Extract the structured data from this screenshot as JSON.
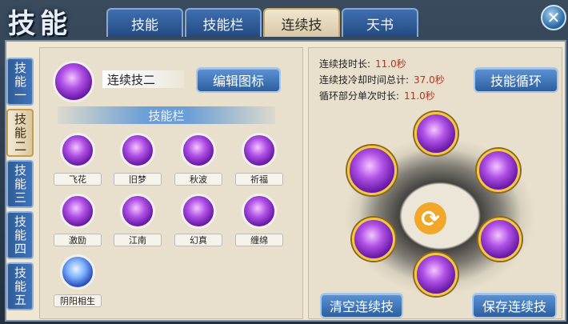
{
  "window": {
    "title": "技能"
  },
  "tabs": [
    {
      "label": "技能",
      "active": false
    },
    {
      "label": "技能栏",
      "active": false
    },
    {
      "label": "连续技",
      "active": true
    },
    {
      "label": "天书",
      "active": false
    }
  ],
  "close_icon": "close-icon",
  "side_tabs": [
    {
      "label": "技能一",
      "active": false
    },
    {
      "label": "技能二",
      "active": true
    },
    {
      "label": "技能三",
      "active": false
    },
    {
      "label": "技能四",
      "active": false
    },
    {
      "label": "技能五",
      "active": false
    }
  ],
  "combo": {
    "name": "连续技二",
    "edit_icon_button": "编辑图标",
    "skillbar_header": "技能栏",
    "skills": [
      "飞花",
      "旧梦",
      "秋波",
      "祈福",
      "激励",
      "江南",
      "幻真",
      "缠绵",
      "阴阳相生"
    ]
  },
  "stats": [
    {
      "label": "连续技时长:",
      "value": "11.0秒"
    },
    {
      "label": "连续技冷却时间总计:",
      "value": "37.0秒"
    },
    {
      "label": "循环部分单次时长:",
      "value": "11.0秒"
    }
  ],
  "right": {
    "cycle_button": "技能循环",
    "clear_button": "清空连续技",
    "save_button": "保存连续技",
    "refresh_icon": "refresh-icon"
  },
  "colors": {
    "accent_blue": "#2d5f9e",
    "value_red": "#b5331b",
    "gold": "#f4c644",
    "panel": "#e8e0cc"
  }
}
